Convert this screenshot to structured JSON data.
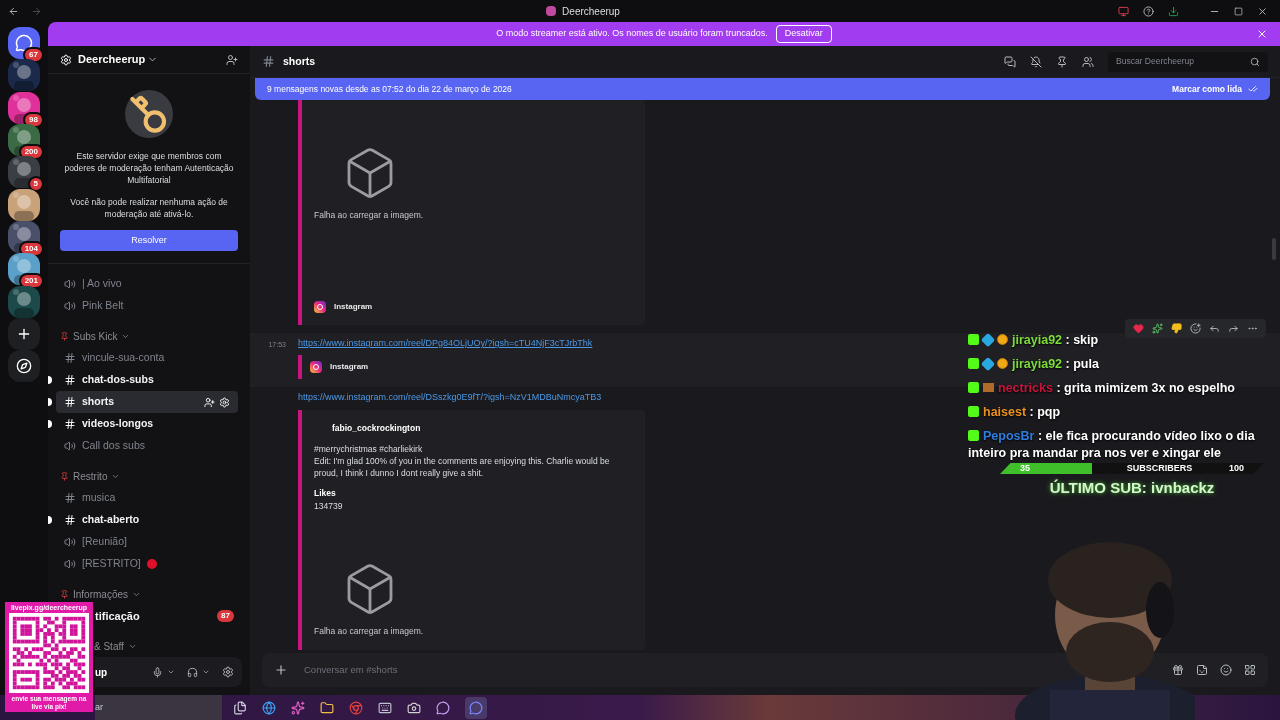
{
  "window": {
    "title": "Deercheerup"
  },
  "servers": [
    {
      "kind": "home",
      "badge": "67",
      "color": "#5865f2"
    },
    {
      "kind": "picture",
      "color": "#1b2a4a"
    },
    {
      "kind": "picture",
      "badge": "98",
      "color": "#e0309a"
    },
    {
      "kind": "picture",
      "badge": "200",
      "color": "#3b6b45"
    },
    {
      "kind": "picture",
      "badge": "5",
      "color": "#3a3f46"
    },
    {
      "kind": "picture",
      "color": "#c9a27a"
    },
    {
      "kind": "picture",
      "badge": "104",
      "color": "#4a4f6a"
    },
    {
      "kind": "picture",
      "badge": "201",
      "color": "#5aa0c8"
    },
    {
      "kind": "picture",
      "color": "#1c4a4a"
    },
    {
      "kind": "add"
    },
    {
      "kind": "discover"
    }
  ],
  "streamer_banner": {
    "text": "O modo streamer está ativo. Os nomes de usuário foram truncados.",
    "button": "Desativar"
  },
  "server": {
    "name": "Deercheerup"
  },
  "mfa_notice": {
    "text": "Este servidor exige que membros com poderes de moderação tenham Autenticação Multifatorial",
    "detail": "Você não pode realizar nenhuma ação de moderação até ativá-lo.",
    "button": "Resolver"
  },
  "channels": [
    {
      "kind": "voice",
      "name": "| Ao vivo"
    },
    {
      "kind": "voice",
      "name": "Pink Belt"
    },
    {
      "kind": "category",
      "name": "Subs Kick"
    },
    {
      "kind": "text",
      "name": "vincule-sua-conta",
      "unread": false,
      "selected": false
    },
    {
      "kind": "text",
      "name": "chat-dos-subs",
      "unread": true,
      "selected": false
    },
    {
      "kind": "text",
      "name": "shorts",
      "unread": true,
      "selected": true
    },
    {
      "kind": "text",
      "name": "videos-longos",
      "unread": true,
      "selected": false
    },
    {
      "kind": "voice",
      "name": "Call dos subs"
    },
    {
      "kind": "category",
      "name": "Restrito"
    },
    {
      "kind": "text",
      "name": "musica",
      "unread": false,
      "selected": false
    },
    {
      "kind": "text",
      "name": "chat-aberto",
      "unread": true,
      "selected": false
    },
    {
      "kind": "voice",
      "name": "[Reunião]"
    },
    {
      "kind": "voice",
      "name": "[RESTRITO]",
      "alert": true
    },
    {
      "kind": "category",
      "name": "Informações"
    },
    {
      "kind": "partial",
      "name": "tificação",
      "badge": "87"
    },
    {
      "kind": "partial_category",
      "name": "& Staff"
    }
  ],
  "user_panel": {
    "name": "up"
  },
  "channel_header": {
    "name": "shorts",
    "search_placeholder": "Buscar Deercheerup"
  },
  "new_messages_bar": {
    "text": "9 mensagens novas desde as 07:52 do dia 22 de março de 2026",
    "action": "Marcar como lida"
  },
  "messages": [
    {
      "kind": "embed",
      "failed_image": "Falha ao carregar a imagem.",
      "provider": "Instagram"
    },
    {
      "kind": "link",
      "time": "17:53",
      "hovered": true,
      "url": "https://www.instagram.com/reel/DPg84OLjUOy/?igsh=cTU4NjF3cTJrbThk",
      "provider": "Instagram"
    },
    {
      "kind": "link_embed",
      "url": "https://www.instagram.com/reel/DSszkg0E9fT/?igsh=NzV1MDBuNmcyaTB3",
      "author": "fabio_cockrockington",
      "description": [
        "#merrychristmas #charliekirk",
        "Edit: I'm glad 100% of you in the comments are enjoying this. Charlie would be proud, I think I dunno I dont really give a shit."
      ],
      "field_name": "Likes",
      "field_value": "134739",
      "failed_image": "Falha ao carregar a imagem."
    }
  ],
  "composer": {
    "placeholder": "Conversar em #shorts"
  },
  "taskbar": {
    "search": "ar"
  },
  "stream_overlay": {
    "qr": {
      "url": "livepix.gg/deercheerup",
      "caption": "envie sua mensagem na live via pix!"
    },
    "chat": [
      {
        "badges": [
          {
            "kind": "kick"
          },
          {
            "kind": "cube"
          },
          {
            "kind": "coin"
          }
        ],
        "user": "jirayia92",
        "color": "#7ddc3a",
        "text": ": skip"
      },
      {
        "badges": [
          {
            "kind": "kick"
          },
          {
            "kind": "cube"
          },
          {
            "kind": "coin"
          }
        ],
        "user": "jirayia92",
        "color": "#7ddc3a",
        "text": ": pula"
      },
      {
        "badges": [
          {
            "kind": "kick"
          },
          {
            "kind": "pixel"
          }
        ],
        "user": "nectricks",
        "color": "#c8143c",
        "text": ": grita mimizem 3x no espelho"
      },
      {
        "badges": [
          {
            "kind": "kick"
          }
        ],
        "user": "haisest",
        "color": "#e8901e",
        "text": ": pqp"
      },
      {
        "badges": [
          {
            "kind": "kick"
          }
        ],
        "user": "PeposBr",
        "color": "#2e7de0",
        "text": ": ele fica procurando vídeo lixo o dia inteiro pra mandar pra nos ver e xingar ele"
      }
    ],
    "goal": {
      "current": "35",
      "label": "SUBSCRIBERS",
      "target": "100",
      "level": 0.35
    },
    "last_sub": "ÚLTIMO SUB: ivnbackz"
  }
}
